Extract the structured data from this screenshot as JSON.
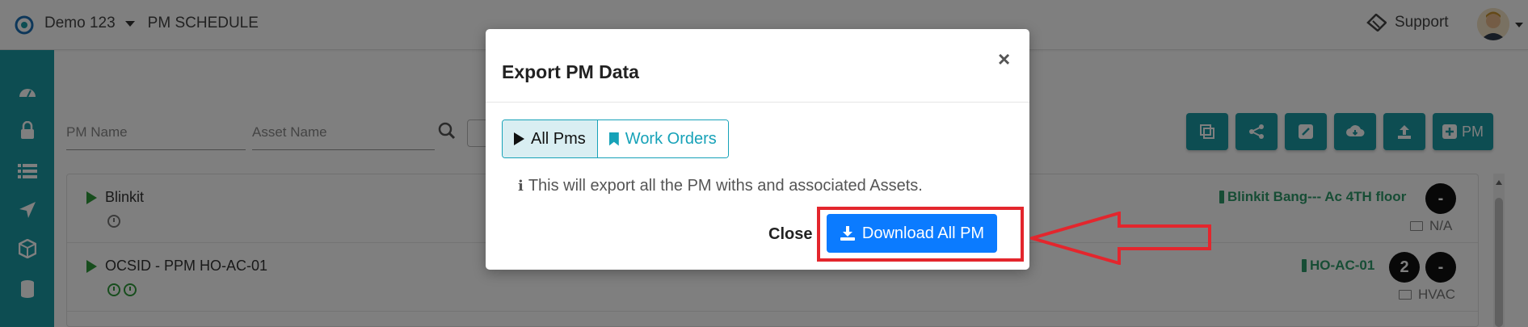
{
  "header": {
    "org_name": "Demo 123",
    "module": "PM SCHEDULE",
    "support_label": "Support"
  },
  "filters": {
    "pm_name_placeholder": "PM Name",
    "asset_name_placeholder": "Asset Name"
  },
  "toolbar": {
    "new_pm_label": "PM"
  },
  "rows": [
    {
      "name": "Blinkit",
      "asset": "Blinkit Bang--- Ac 4TH floor",
      "category": "N/A",
      "badges": [
        "-"
      ]
    },
    {
      "name": "OCSID - PPM HO-AC-01",
      "asset": "HO-AC-01",
      "category": "HVAC",
      "badges": [
        "2",
        "-"
      ]
    }
  ],
  "modal": {
    "title": "Export PM Data",
    "close_x": "×",
    "tabs": [
      {
        "label": "All Pms",
        "active": true
      },
      {
        "label": "Work Orders",
        "active": false
      }
    ],
    "info_icon": "i",
    "info_text": "This will export all the PM withs and associated Assets.",
    "close_label": "Close",
    "download_label": "Download All PM"
  },
  "colors": {
    "brand_teal": "#1b9aa5",
    "primary_blue": "#0b7bff",
    "info_cyan": "#17a2b8",
    "annotation_red": "#e3262d",
    "status_green": "#2e9b3a"
  }
}
